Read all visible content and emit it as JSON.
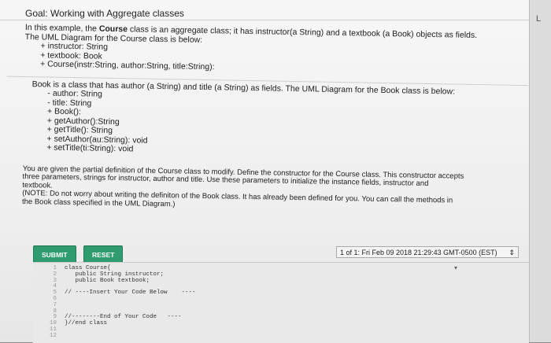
{
  "goal": "Goal: Working with Aggregate classes",
  "side_label": "L",
  "intro": {
    "l1a": "In this example, the ",
    "l1b": "Course",
    "l1c": " class is an aggregate class; it has instructor(a String) and a textbook (a Book) objects as fields.",
    "l2": "The UML Diagram for the Course class is below:",
    "items": [
      "+ instructor: String",
      "+ textbook: Book",
      "+ Course(instr:String, author:String, title:String):"
    ]
  },
  "book": {
    "line": "Book is a class that has author (a String) and title (a String) as fields. The UML Diagram for the Book class is below:",
    "items": [
      "- author: String",
      "- title: String",
      "+ Book():",
      "+ getAuthor():String",
      "+ getTitle(): String",
      "+ setAuthor(au:String): void",
      "+ setTitle(ti:String): void"
    ]
  },
  "task": {
    "l1": "You are given the partial definition of the Course class to modify. Define the constructor for the Course class. This constructor accepts",
    "l2": "three parameters, strings for instructor, author and title. Use these parameters to initialize the instance fields, instructor and",
    "l3": "textbook.",
    "l4": "(NOTE: Do not worry about writing the definiton of the Book class. It has already been defined for you. You can call the methods in",
    "l5": "the Book class specified in the UML Diagram.)"
  },
  "buttons": {
    "submit": "SUBMIT",
    "reset": "RESET"
  },
  "status": "1 of 1: Fri Feb 09 2018 21:29:43 GMT-0500 (EST)",
  "editor": {
    "line_numbers": "1\n2\n3\n4\n5\n6\n7\n8\n9\n10\n11\n12",
    "code": "class Course{\n   public String instructor;\n   public Book textbook;\n\n// ----Insert Your Code Below    ----\n\n\n\n//--------End of Your Code   ----\n}//end class\n\n"
  }
}
